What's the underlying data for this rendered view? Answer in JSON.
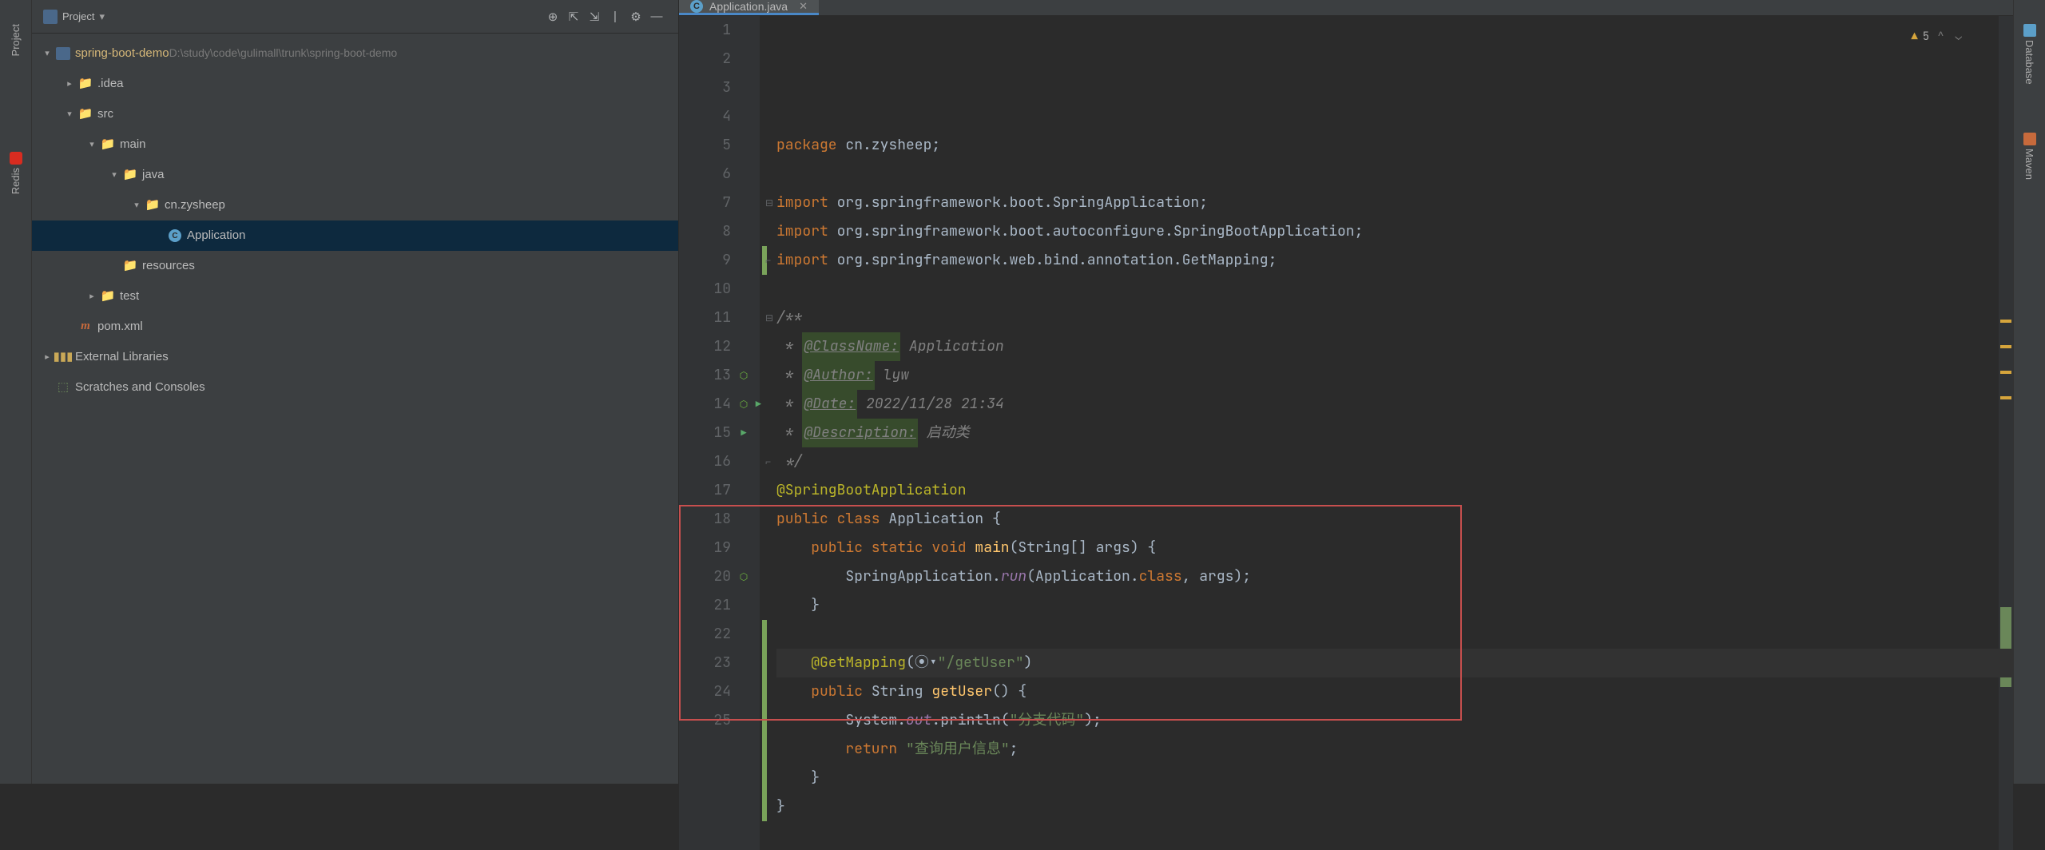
{
  "left_strip": {
    "labels": [
      "Project",
      "Redis"
    ]
  },
  "right_strip": {
    "labels": [
      "Database",
      "Maven"
    ]
  },
  "project_panel": {
    "title": "Project",
    "tree": [
      {
        "indent": 0,
        "arrow": "▾",
        "icon": "module",
        "label": "spring-boot-demo",
        "suffix": "D:\\study\\code\\gulimall\\trunk\\spring-boot-demo",
        "selected": false,
        "labelClass": "module"
      },
      {
        "indent": 1,
        "arrow": "▸",
        "icon": "folder-orange",
        "label": ".idea",
        "labelClass": ""
      },
      {
        "indent": 1,
        "arrow": "▾",
        "icon": "folder",
        "label": "src"
      },
      {
        "indent": 2,
        "arrow": "▾",
        "icon": "folder",
        "label": "main"
      },
      {
        "indent": 3,
        "arrow": "▾",
        "icon": "folder",
        "label": "java"
      },
      {
        "indent": 4,
        "arrow": "▾",
        "icon": "folder",
        "label": "cn.zysheep"
      },
      {
        "indent": 5,
        "arrow": "",
        "icon": "class",
        "label": "Application",
        "selected": true
      },
      {
        "indent": 3,
        "arrow": "",
        "icon": "folder",
        "label": "resources"
      },
      {
        "indent": 2,
        "arrow": "▸",
        "icon": "folder",
        "label": "test"
      },
      {
        "indent": 1,
        "arrow": "",
        "icon": "maven",
        "label": "pom.xml"
      },
      {
        "indent": 0,
        "arrow": "▸",
        "icon": "libraries",
        "label": "External Libraries"
      },
      {
        "indent": 0,
        "arrow": "",
        "icon": "scratches",
        "label": "Scratches and Consoles"
      }
    ]
  },
  "editor": {
    "tab": {
      "label": "Application.java"
    },
    "warnings": {
      "count": "5"
    },
    "lines": [
      {
        "n": "1",
        "segs": [
          {
            "c": "kw",
            "t": "package "
          },
          {
            "c": "pkg-imp",
            "t": "cn.zysheep"
          },
          {
            "c": "",
            "t": ";"
          }
        ]
      },
      {
        "n": "2",
        "segs": []
      },
      {
        "n": "3",
        "segs": [
          {
            "c": "kw",
            "t": "import "
          },
          {
            "c": "pkg-imp",
            "t": "org.springframework.boot.SpringApplication"
          },
          {
            "c": "",
            "t": ";"
          }
        ],
        "fold": "start"
      },
      {
        "n": "4",
        "segs": [
          {
            "c": "kw",
            "t": "import "
          },
          {
            "c": "pkg-imp",
            "t": "org.springframework.boot.autoconfigure."
          },
          {
            "c": "sbapp",
            "t": "SpringBootApplication"
          },
          {
            "c": "",
            "t": ";"
          }
        ]
      },
      {
        "n": "5",
        "segs": [
          {
            "c": "kw",
            "t": "import "
          },
          {
            "c": "pkg-imp",
            "t": "org.springframework.web.bind.annotation.GetMapping"
          },
          {
            "c": "",
            "t": ";"
          }
        ],
        "fold": "end",
        "vcs": true
      },
      {
        "n": "6",
        "segs": []
      },
      {
        "n": "7",
        "segs": [
          {
            "c": "comm",
            "t": "/**"
          }
        ],
        "fold": "start"
      },
      {
        "n": "8",
        "segs": [
          {
            "c": "comm",
            "t": " * "
          },
          {
            "c": "highlight-tag comm",
            "t": "@ClassName:"
          },
          {
            "c": "comm",
            "t": " Application"
          }
        ]
      },
      {
        "n": "9",
        "segs": [
          {
            "c": "comm",
            "t": " * "
          },
          {
            "c": "highlight-tag comm",
            "t": "@Author:"
          },
          {
            "c": "comm",
            "t": " lyw"
          }
        ]
      },
      {
        "n": "10",
        "segs": [
          {
            "c": "comm",
            "t": " * "
          },
          {
            "c": "highlight-tag comm",
            "t": "@Date:"
          },
          {
            "c": "comm",
            "t": " 2022/11/28 21:34"
          }
        ]
      },
      {
        "n": "11",
        "segs": [
          {
            "c": "comm",
            "t": " * "
          },
          {
            "c": "highlight-tag comm",
            "t": "@Description:"
          },
          {
            "c": "comm",
            "t": " 启动类"
          }
        ]
      },
      {
        "n": "12",
        "segs": [
          {
            "c": "comm",
            "t": " */"
          }
        ],
        "fold": "end"
      },
      {
        "n": "13",
        "segs": [
          {
            "c": "anno",
            "t": "@SpringBootApplication"
          }
        ],
        "gicon": "spring"
      },
      {
        "n": "14",
        "segs": [
          {
            "c": "kw",
            "t": "public class "
          },
          {
            "c": "cls-name",
            "t": "Application"
          },
          {
            "c": "",
            "t": " {"
          }
        ],
        "gicon": "spring-run"
      },
      {
        "n": "15",
        "segs": [
          {
            "c": "",
            "t": "    "
          },
          {
            "c": "kw",
            "t": "public static void "
          },
          {
            "c": "fn",
            "t": "main"
          },
          {
            "c": "",
            "t": "(String[] "
          },
          {
            "c": "",
            "t": "args"
          },
          {
            "c": "",
            "t": ") {"
          }
        ],
        "gicon": "run"
      },
      {
        "n": "16",
        "segs": [
          {
            "c": "",
            "t": "        SpringApplication."
          },
          {
            "c": "field",
            "t": "run"
          },
          {
            "c": "",
            "t": "(Application."
          },
          {
            "c": "kw",
            "t": "class"
          },
          {
            "c": "",
            "t": ", "
          },
          {
            "c": "",
            "t": "args"
          },
          {
            "c": "",
            "t": ");"
          }
        ]
      },
      {
        "n": "17",
        "segs": [
          {
            "c": "",
            "t": "    }"
          }
        ]
      },
      {
        "n": "18",
        "segs": [],
        "vcs": true
      },
      {
        "n": "19",
        "segs": [
          {
            "c": "",
            "t": "    "
          },
          {
            "c": "anno",
            "t": "@GetMapping"
          },
          {
            "c": "",
            "t": "("
          },
          {
            "c": "",
            "t": "⦿▾"
          },
          {
            "c": "str",
            "t": "\"/getUser\""
          },
          {
            "c": "",
            "t": ")"
          }
        ],
        "vcs": true,
        "caret": true
      },
      {
        "n": "20",
        "segs": [
          {
            "c": "",
            "t": "    "
          },
          {
            "c": "kw",
            "t": "public "
          },
          {
            "c": "",
            "t": "String "
          },
          {
            "c": "fn",
            "t": "getUser"
          },
          {
            "c": "",
            "t": "() {"
          }
        ],
        "gicon": "spring",
        "vcs": true
      },
      {
        "n": "21",
        "segs": [
          {
            "c": "",
            "t": "        System."
          },
          {
            "c": "field",
            "t": "out"
          },
          {
            "c": "",
            "t": ".println("
          },
          {
            "c": "str",
            "t": "\"分支代码\""
          },
          {
            "c": "",
            "t": ");"
          }
        ],
        "vcs": true
      },
      {
        "n": "22",
        "segs": [
          {
            "c": "",
            "t": "        "
          },
          {
            "c": "kw",
            "t": "return "
          },
          {
            "c": "str",
            "t": "\"查询用户信息\""
          },
          {
            "c": "",
            "t": ";"
          }
        ],
        "vcs": true
      },
      {
        "n": "23",
        "segs": [
          {
            "c": "",
            "t": "    }"
          }
        ],
        "vcs": true
      },
      {
        "n": "24",
        "segs": [
          {
            "c": "",
            "t": "}"
          }
        ],
        "vcs": true
      },
      {
        "n": "25",
        "segs": []
      }
    ]
  }
}
